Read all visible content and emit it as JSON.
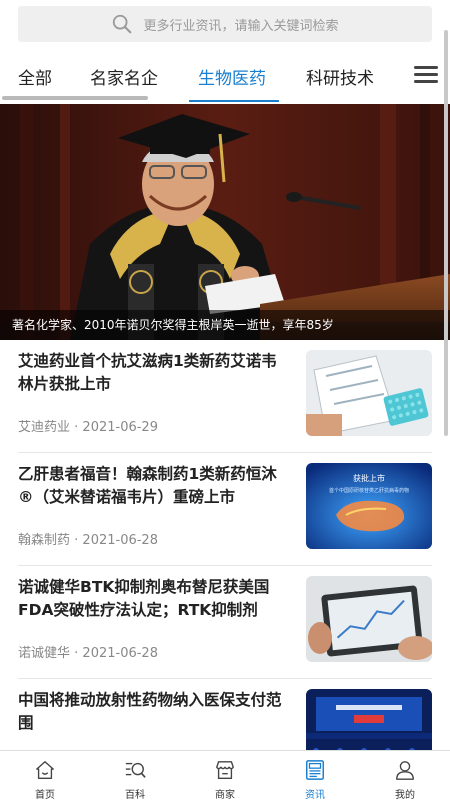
{
  "search": {
    "placeholder": "更多行业资讯，请输入关键词检索"
  },
  "tabs": [
    {
      "label": "全部"
    },
    {
      "label": "名家名企"
    },
    {
      "label": "生物医药",
      "active": true
    },
    {
      "label": "科研技术"
    }
  ],
  "hero": {
    "caption": "著名化学家、2010年诺贝尔奖得主根岸英一逝世，享年85岁"
  },
  "news": [
    {
      "title": "艾迪药业首个抗艾滋病1类新药艾诺韦林片获批上市",
      "source": "艾迪药业",
      "date": "2021-06-29"
    },
    {
      "title": "乙肝患者福音！翰森制药1类新药恒沐®（艾米替诺福韦片）重磅上市",
      "source": "翰森制药",
      "date": "2021-06-28"
    },
    {
      "title": "诺诚健华BTK抑制剂奥布替尼获美国FDA突破性疗法认定；RTK抑制剂IC…",
      "source": "诺诚健华",
      "date": "2021-06-28"
    },
    {
      "title": "中国将推动放射性药物纳入医保支付范围",
      "source": "",
      "date": ""
    }
  ],
  "thumb_texts": {
    "news2_line1": "获批上市",
    "news2_line2": "首个中国原研核苷类乙肝抗病毒药物"
  },
  "nav": [
    {
      "label": "首页",
      "icon": "home-icon"
    },
    {
      "label": "百科",
      "icon": "encyclopedia-search-icon"
    },
    {
      "label": "商家",
      "icon": "store-icon"
    },
    {
      "label": "资讯",
      "icon": "news-icon",
      "active": true
    },
    {
      "label": "我的",
      "icon": "user-icon"
    }
  ],
  "colors": {
    "accent": "#1a7fd0",
    "text": "#222222",
    "meta": "#888888"
  }
}
